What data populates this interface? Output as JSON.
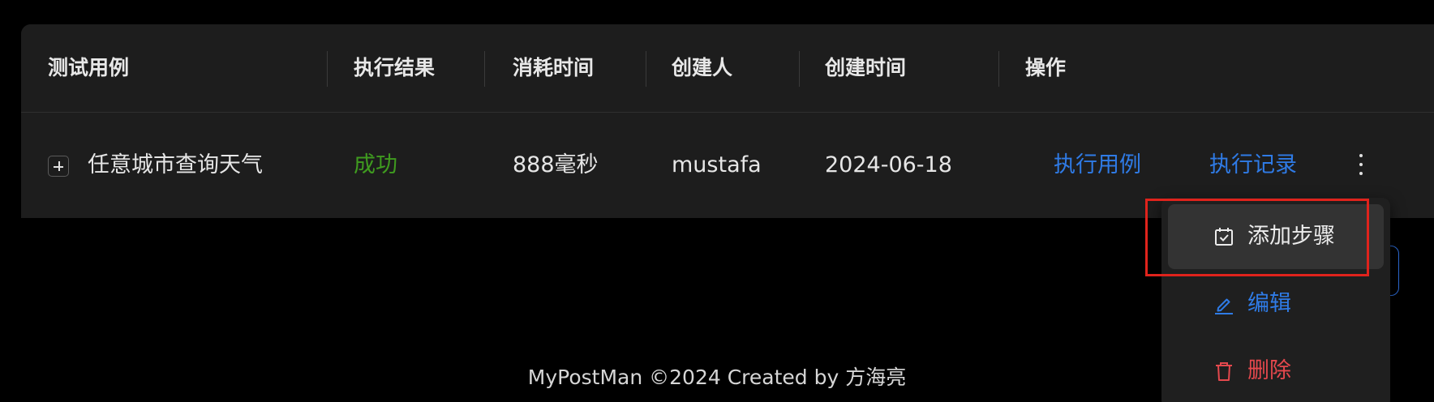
{
  "table": {
    "columns": [
      "测试用例",
      "执行结果",
      "消耗时间",
      "创建人",
      "创建时间",
      "操作"
    ],
    "rows": [
      {
        "test_case": "任意城市查询天气",
        "result": "成功",
        "duration": "888毫秒",
        "creator": "mustafa",
        "created_at": "2024-06-18",
        "actions": [
          "执行用例",
          "执行记录"
        ]
      }
    ]
  },
  "dropdown": {
    "items": [
      {
        "label": "添加步骤",
        "icon": "calendar-check-icon"
      },
      {
        "label": "编辑",
        "icon": "edit-pencil-icon"
      },
      {
        "label": "删除",
        "icon": "trash-icon"
      }
    ]
  },
  "footer": {
    "text": "MyPostMan ©2024 Created by 方海亮"
  },
  "colors": {
    "success": "#3f9b1f",
    "link": "#2f7be6",
    "danger": "#e5484d",
    "highlight": "#e0231c"
  }
}
